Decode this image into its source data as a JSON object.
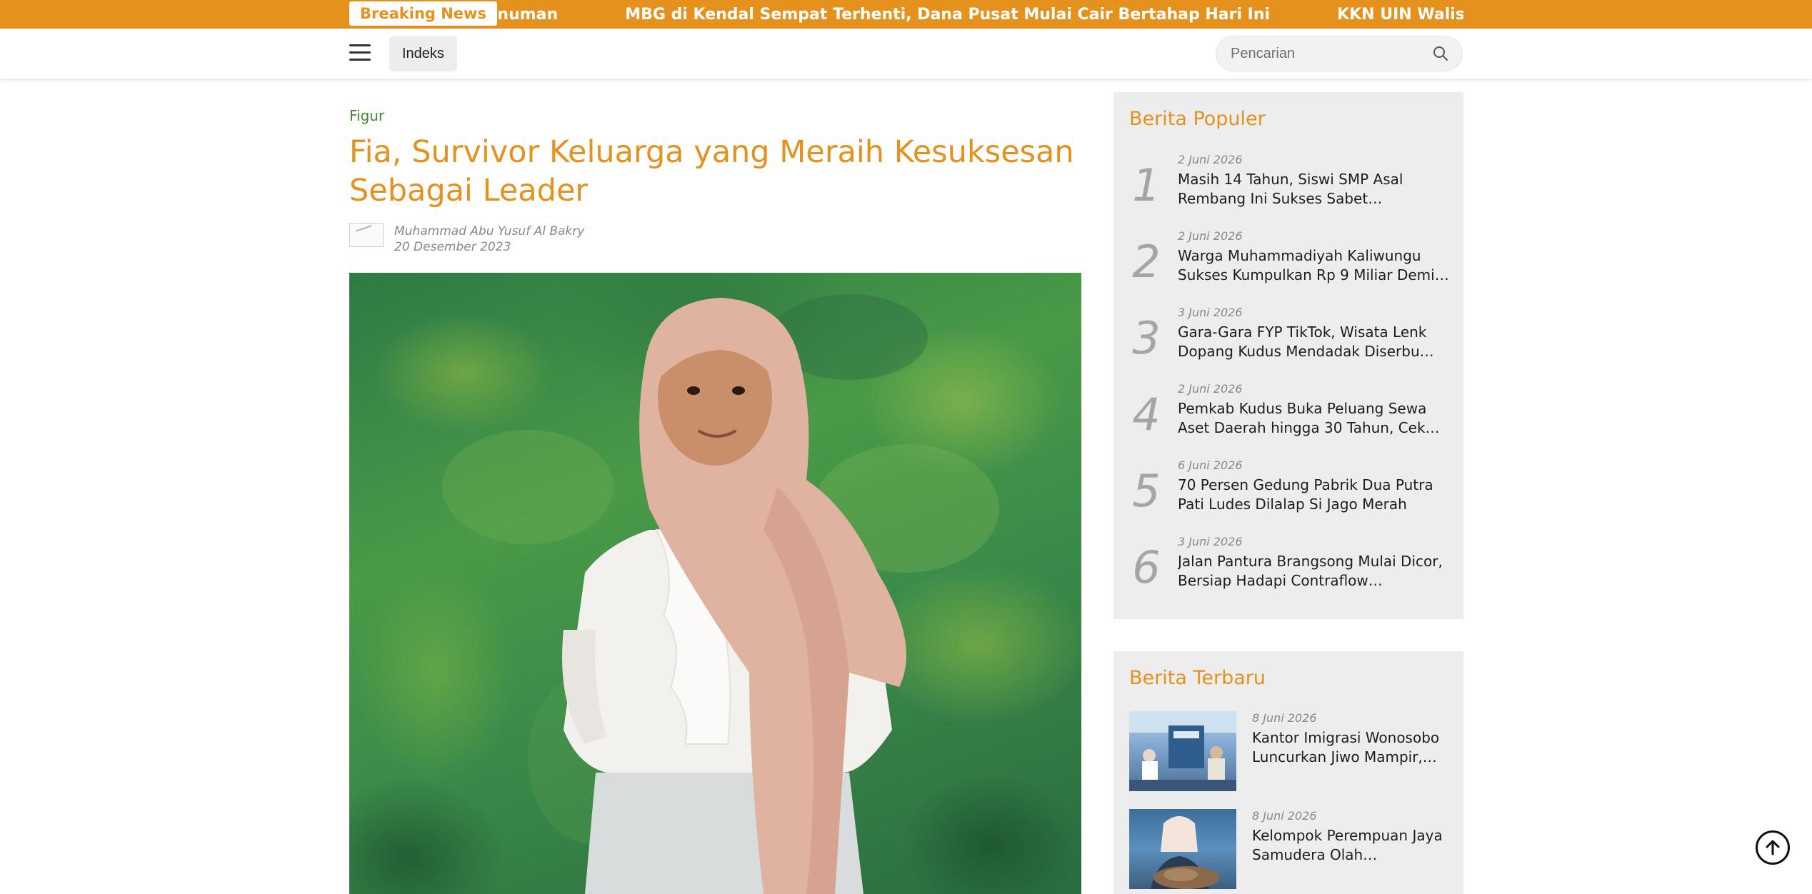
{
  "breaking": {
    "label": "Breaking News",
    "items": [
      "Minuman",
      "MBG di Kendal Sempat Terhenti, Dana Pusat Mulai Cair Bertahap Hari Ini",
      "KKN UIN Walisongo Gelar Seminar U"
    ]
  },
  "nav": {
    "menu_icon": "hamburger-menu-icon",
    "indeks_label": "Indeks",
    "search_placeholder": "Pencarian",
    "search_icon": "search-icon"
  },
  "article": {
    "category": "Figur",
    "title": "Fia, Survivor Keluarga yang Meraih Kesuksesan Sebagai Leader",
    "author": "Muhammad Abu Yusuf Al Bakry",
    "date": "20 Desember 2023"
  },
  "sidebar": {
    "populer": {
      "title": "Berita Populer",
      "items": [
        {
          "num": "1",
          "date": "2 Juni 2026",
          "title": "Masih 14 Tahun, Siswi SMP Asal Rembang Ini Sukses Sabet…"
        },
        {
          "num": "2",
          "date": "2 Juni 2026",
          "title": "Warga Muhammadiyah Kaliwungu Sukses Kumpulkan Rp 9 Miliar Demi…"
        },
        {
          "num": "3",
          "date": "3 Juni 2026",
          "title": "Gara-Gara FYP TikTok, Wisata Lenk Dopang Kudus Mendadak Diserbu…"
        },
        {
          "num": "4",
          "date": "2 Juni 2026",
          "title": "Pemkab Kudus Buka Peluang Sewa Aset Daerah hingga 30 Tahun, Cek…"
        },
        {
          "num": "5",
          "date": "6 Juni 2026",
          "title": "70 Persen Gedung Pabrik Dua Putra Pati Ludes Dilalap Si Jago Merah"
        },
        {
          "num": "6",
          "date": "3 Juni 2026",
          "title": "Jalan Pantura Brangsong Mulai Dicor, Bersiap Hadapi Contraflow…"
        }
      ]
    },
    "terbaru": {
      "title": "Berita Terbaru",
      "items": [
        {
          "date": "8 Juni 2026",
          "title": "Kantor Imigrasi Wonosobo Luncurkan Jiwo Mampir,…"
        },
        {
          "date": "8 Juni 2026",
          "title": "Kelompok Perempuan Jaya Samudera Olah…"
        }
      ]
    }
  },
  "colors": {
    "accent": "#e4911e",
    "category_green": "#3e8a2e",
    "panel_bg": "#ededed"
  },
  "icons": {
    "back_to_top": "arrow-up-circle-icon"
  }
}
